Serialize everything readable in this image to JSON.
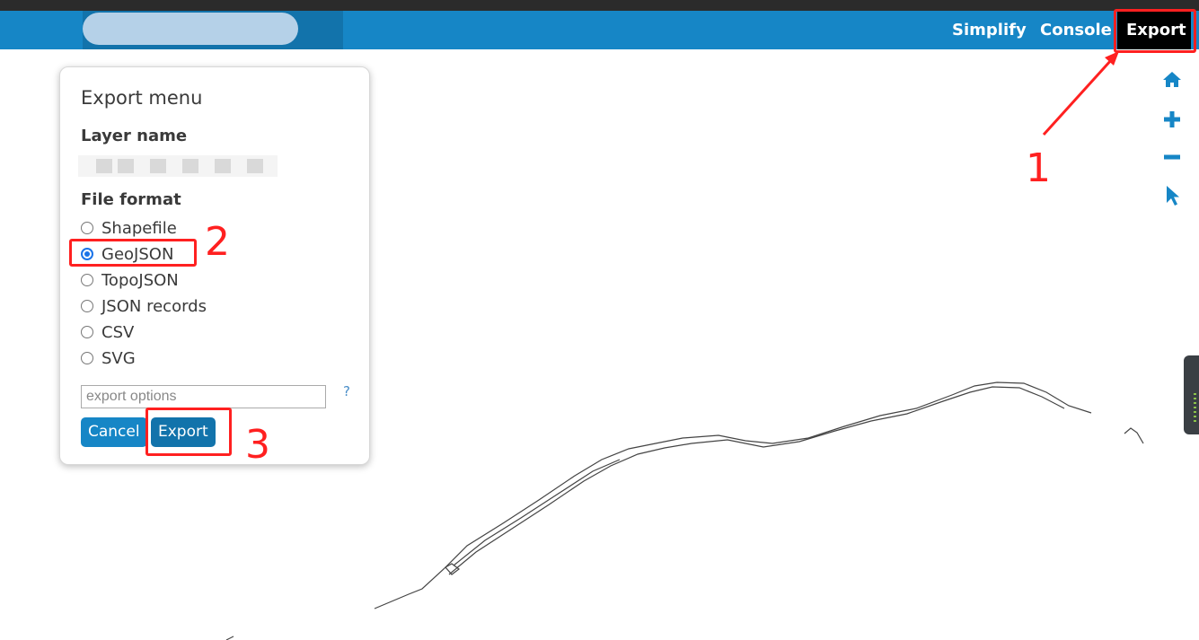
{
  "topbar": {
    "simplify_label": "Simplify",
    "console_label": "Console",
    "export_label": "Export",
    "layer_caret": "▼",
    "color": "#1686c6"
  },
  "tools": [
    "home-icon",
    "zoom-in-icon",
    "zoom-out-icon",
    "select-pointer-icon"
  ],
  "export_menu": {
    "title": "Export menu",
    "layer_name_label": "Layer name",
    "file_format_label": "File format",
    "formats": [
      "Shapefile",
      "GeoJSON",
      "TopoJSON",
      "JSON records",
      "CSV",
      "SVG"
    ],
    "selected_format": "GeoJSON",
    "options_placeholder": "export options",
    "help_label": "?",
    "cancel_label": "Cancel",
    "export_label": "Export"
  },
  "annotations": [
    "1",
    "2",
    "3"
  ],
  "accent_color": "#ff2020"
}
